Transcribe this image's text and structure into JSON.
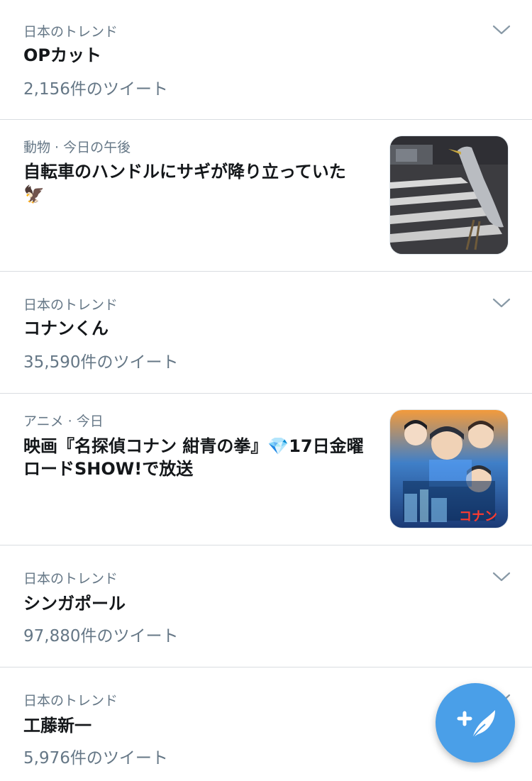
{
  "feed": [
    {
      "type": "trend",
      "meta": "日本のトレンド",
      "title": "OPカット",
      "count": "2,156件のツイート"
    },
    {
      "type": "news",
      "meta": "動物 · 今日の午後",
      "title_line1": "自転車のハンドルにサギが降り立っていた",
      "title_line2": "🦅"
    },
    {
      "type": "trend",
      "meta": "日本のトレンド",
      "title": "コナンくん",
      "count": "35,590件のツイート"
    },
    {
      "type": "news",
      "meta": "アニメ · 今日",
      "title_line1": "映画『名探偵コナン 紺青の拳』💎17日金曜",
      "title_line2": "ロードSHOW!で放送",
      "poster_text": "コナン"
    },
    {
      "type": "trend",
      "meta": "日本のトレンド",
      "title": "シンガポール",
      "count": "97,880件のツイート"
    },
    {
      "type": "trend",
      "meta": "日本のトレンド",
      "title": "工藤新一",
      "count": "5,976件のツイート"
    }
  ],
  "icons": {
    "chevron": "chevron-down-icon",
    "compose": "compose-tweet-icon"
  },
  "colors": {
    "accent": "#4a9fe8",
    "secondary_text": "#657786",
    "divider": "#d9dde1"
  }
}
